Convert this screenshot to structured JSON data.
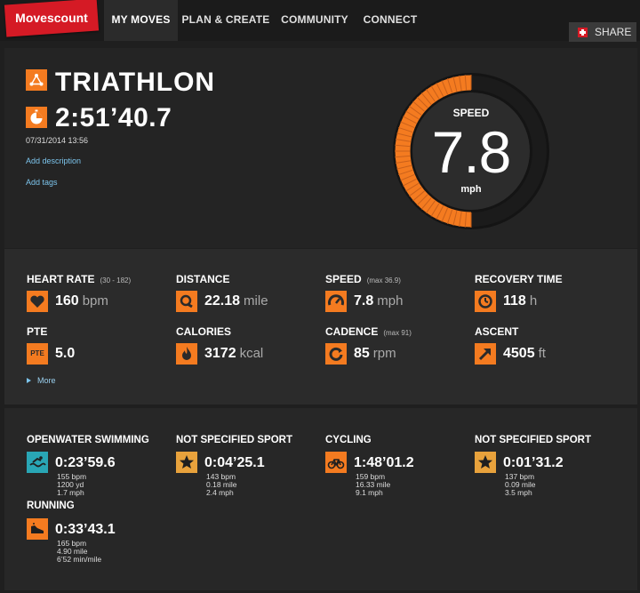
{
  "nav": {
    "logo": "Movescount",
    "items": [
      "MY MOVES",
      "PLAN & CREATE",
      "COMMUNITY",
      "CONNECT"
    ],
    "share": "SHARE"
  },
  "move": {
    "activity": "TRIATHLON",
    "duration": "2:51’40.7",
    "date": "07/31/2014 13:56",
    "add_description": "Add description",
    "add_tags": "Add tags"
  },
  "gauge": {
    "label": "SPEED",
    "value": "7.8",
    "unit": "mph",
    "fill_fraction": 0.5,
    "color": "#f47b20"
  },
  "stats": [
    {
      "label": "HEART RATE",
      "note": "(30 - 182)",
      "value": "160",
      "unit": "bpm",
      "icon": "heart-icon"
    },
    {
      "label": "DISTANCE",
      "note": "",
      "value": "22.18",
      "unit": "mile",
      "icon": "distance-icon"
    },
    {
      "label": "SPEED",
      "note": "(max 36.9)",
      "value": "7.8",
      "unit": "mph",
      "icon": "speedometer-icon"
    },
    {
      "label": "RECOVERY TIME",
      "note": "",
      "value": "118",
      "unit": "h",
      "icon": "recovery-icon"
    },
    {
      "label": "PTE",
      "note": "",
      "value": "5.0",
      "unit": "",
      "icon": "pte-icon",
      "icon_text": "PTE"
    },
    {
      "label": "CALORIES",
      "note": "",
      "value": "3172",
      "unit": "kcal",
      "icon": "flame-icon"
    },
    {
      "label": "CADENCE",
      "note": "(max 91)",
      "value": "85",
      "unit": "rpm",
      "icon": "cadence-icon"
    },
    {
      "label": "ASCENT",
      "note": "",
      "value": "4505",
      "unit": "ft",
      "icon": "ascent-arrow-icon"
    }
  ],
  "more": "More",
  "sports": [
    {
      "name": "OPENWATER SWIMMING",
      "time": "0:23’59.6",
      "lines": [
        "155 bpm",
        "1200 yd",
        "1.7 mph"
      ],
      "icon": "swimming-icon",
      "color": "#29a6b5"
    },
    {
      "name": "NOT SPECIFIED SPORT",
      "time": "0:04’25.1",
      "lines": [
        "143 bpm",
        "0.18 mile",
        "2.4 mph"
      ],
      "icon": "star-icon",
      "color": "#e8a23c"
    },
    {
      "name": "CYCLING",
      "time": "1:48’01.2",
      "lines": [
        "159 bpm",
        "16.33 mile",
        "9.1 mph"
      ],
      "icon": "bicycle-icon",
      "color": "#f47b20"
    },
    {
      "name": "NOT SPECIFIED SPORT",
      "time": "0:01’31.2",
      "lines": [
        "137 bpm",
        "0.09 mile",
        "3.5 mph"
      ],
      "icon": "star-icon",
      "color": "#e8a23c"
    },
    {
      "name": "RUNNING",
      "time": "0:33’43.1",
      "lines": [
        "165 bpm",
        "4.90 mile",
        "6’52 min/mile"
      ],
      "icon": "running-shoe-icon",
      "color": "#f47b20"
    }
  ]
}
